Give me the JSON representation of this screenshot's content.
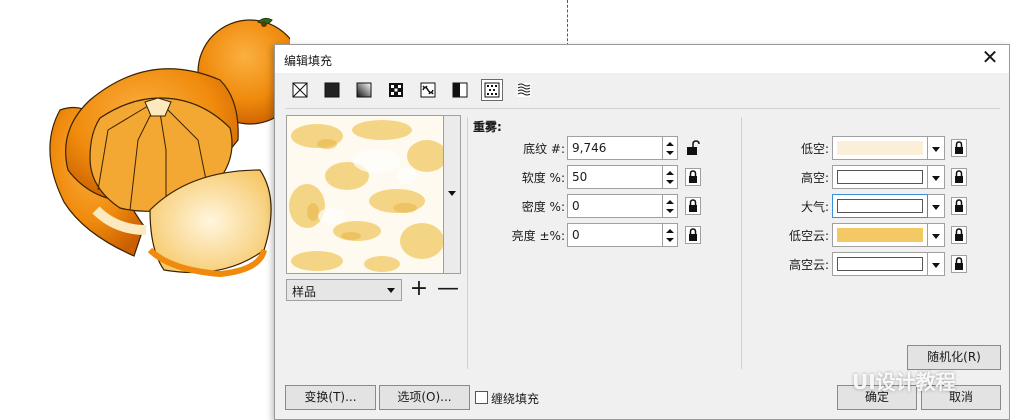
{
  "dialog": {
    "title": "编辑填充",
    "close_glyph": "✕"
  },
  "toolbar": {
    "fill_types": [
      {
        "icon": "no-fill-icon"
      },
      {
        "icon": "uniform-fill-icon"
      },
      {
        "icon": "fountain-fill-icon"
      },
      {
        "icon": "vector-pattern-fill-icon"
      },
      {
        "icon": "bitmap-pattern-fill-icon"
      },
      {
        "icon": "two-color-pattern-fill-icon"
      },
      {
        "icon": "texture-fill-icon",
        "active": true
      },
      {
        "icon": "postscript-fill-icon"
      }
    ]
  },
  "preview": {
    "sample_select_value": "样品",
    "add_glyph": "+",
    "remove_glyph": "—"
  },
  "params": {
    "section_title": "重雾:",
    "rows": [
      {
        "label": "底纹 #:",
        "value": "9,746",
        "lock": "unlocked"
      },
      {
        "label": "软度 %:",
        "value": "50",
        "lock": "locked"
      },
      {
        "label": "密度 %:",
        "value": "0",
        "lock": "locked"
      },
      {
        "label": "亮度 ±%:",
        "value": "0",
        "lock": "locked"
      }
    ]
  },
  "colors": {
    "rows": [
      {
        "label": "低空:",
        "color": "#fbefd9",
        "swatch_border": false
      },
      {
        "label": "高空:",
        "color": "#ffffff",
        "swatch_border": true
      },
      {
        "label": "大气:",
        "color": "#ffffff",
        "swatch_border": true,
        "focused": true
      },
      {
        "label": "低空云:",
        "color": "#f5c866",
        "swatch_border": false
      },
      {
        "label": "高空云:",
        "color": "#ffffff",
        "swatch_border": true
      }
    ]
  },
  "buttons": {
    "randomize": "随机化(R)",
    "transform": "变换(T)...",
    "options": "选项(O)...",
    "wrap_fill": "缠绕填充",
    "ok": "确定",
    "cancel": "取消"
  },
  "watermark": "UI设计教程"
}
